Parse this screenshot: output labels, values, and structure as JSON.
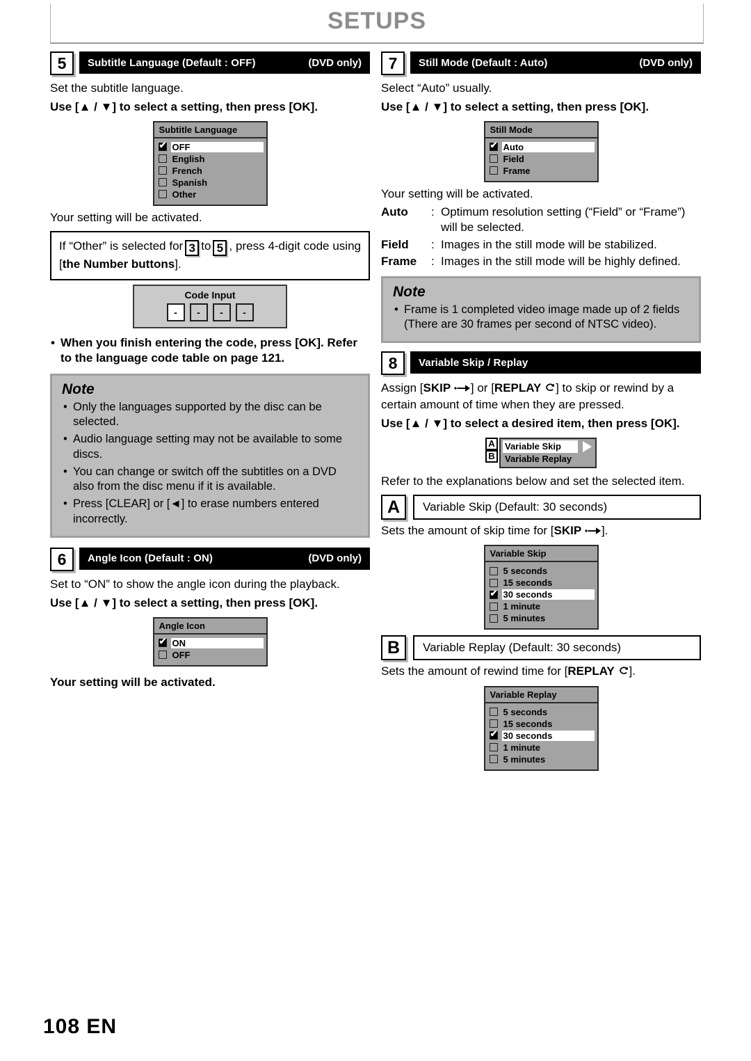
{
  "header": {
    "title": "SETUPS"
  },
  "footer": {
    "page": "108  EN"
  },
  "left": {
    "section5": {
      "number": "5",
      "title": "Subtitle Language (Default : OFF)",
      "note_right": "(DVD only)",
      "intro": "Set the subtitle language.",
      "instruction": "Use [▲ / ▼] to select a setting, then press [OK].",
      "osd": {
        "title": "Subtitle Language",
        "items": [
          {
            "label": "OFF",
            "checked": true
          },
          {
            "label": "English",
            "checked": false
          },
          {
            "label": "French",
            "checked": false
          },
          {
            "label": "Spanish",
            "checked": false
          },
          {
            "label": "Other",
            "checked": false
          }
        ]
      },
      "activated": "Your setting will be activated.",
      "callout": {
        "part1": "If “Other” is selected for",
        "num1": "3",
        "mid": "to",
        "num2": "5",
        "part2": ", press 4-digit code using [",
        "bold": "the Number buttons",
        "part3": "]."
      },
      "code_input": {
        "title": "Code Input",
        "digits": [
          "-",
          "-",
          "-",
          "-"
        ]
      },
      "bullet": "When you finish entering the code, press [OK]. Refer to the language code table on page 121.",
      "note": {
        "title": "Note",
        "items": [
          "Only the languages supported by the disc can be selected.",
          "Audio language setting may not be available to some discs.",
          "You can change or switch off the subtitles on a DVD also from the disc menu if it is available.",
          "Press [CLEAR] or [◄] to erase numbers entered incorrectly."
        ]
      }
    },
    "section6": {
      "number": "6",
      "title": "Angle Icon (Default : ON)",
      "note_right": "(DVD only)",
      "intro": "Set to “ON” to show the angle icon during the playback.",
      "instruction": "Use [▲ / ▼] to select a setting, then press [OK].",
      "osd": {
        "title": "Angle Icon",
        "items": [
          {
            "label": "ON",
            "checked": true
          },
          {
            "label": "OFF",
            "checked": false
          }
        ]
      },
      "activated": "Your setting will be activated."
    }
  },
  "right": {
    "section7": {
      "number": "7",
      "title": "Still Mode (Default : Auto)",
      "note_right": "(DVD only)",
      "intro": "Select “Auto” usually.",
      "instruction": "Use [▲ / ▼] to select a setting, then press [OK].",
      "osd": {
        "title": "Still Mode",
        "items": [
          {
            "label": "Auto",
            "checked": true
          },
          {
            "label": "Field",
            "checked": false
          },
          {
            "label": "Frame",
            "checked": false
          }
        ]
      },
      "activated": "Your setting will be activated.",
      "definitions": [
        {
          "term": "Auto",
          "sep": ":",
          "desc": "Optimum resolution setting (“Field” or “Frame”) will be selected."
        },
        {
          "term": "Field",
          "sep": ":",
          "desc": "Images in the still mode will be stabilized."
        },
        {
          "term": "Frame",
          "sep": ":",
          "desc": "Images in the still mode will be highly defined."
        }
      ],
      "note": {
        "title": "Note",
        "items": [
          "Frame is 1 completed video image made up of 2 fields (There are 30 frames per second of NTSC video)."
        ]
      }
    },
    "section8": {
      "number": "8",
      "title": "Variable Skip / Replay",
      "intro_before_skip": "Assign [",
      "skip_label": "SKIP",
      "skip_icon": "skip-forward-icon",
      "intro_mid": "] or [",
      "replay_label": "REPLAY",
      "replay_icon": "replay-loop-icon",
      "intro_after": "] to skip or rewind by a certain amount of time when they are pressed.",
      "instruction": "Use [▲ / ▼] to select a desired item, then press [OK].",
      "ab_osd": {
        "letters": [
          "A",
          "B"
        ],
        "items": [
          {
            "label": "Variable Skip",
            "selected": true
          },
          {
            "label": "Variable Replay",
            "selected": false
          }
        ]
      },
      "refer": "Refer to the explanations below and set the selected item.",
      "itemA": {
        "letter": "A",
        "bar": "Variable Skip (Default: 30 seconds)",
        "desc_before": "Sets the amount of skip time for [",
        "desc_label": "SKIP",
        "desc_after": "].",
        "osd": {
          "title": "Variable Skip",
          "items": [
            {
              "label": "5 seconds",
              "checked": false
            },
            {
              "label": "15 seconds",
              "checked": false
            },
            {
              "label": "30 seconds",
              "checked": true
            },
            {
              "label": "1 minute",
              "checked": false
            },
            {
              "label": "5 minutes",
              "checked": false
            }
          ]
        }
      },
      "itemB": {
        "letter": "B",
        "bar": "Variable Replay (Default: 30 seconds)",
        "desc_before": "Sets the amount of rewind time for [",
        "desc_label": "REPLAY",
        "desc_after": "].",
        "osd": {
          "title": "Variable Replay",
          "items": [
            {
              "label": "5 seconds",
              "checked": false
            },
            {
              "label": "15 seconds",
              "checked": false
            },
            {
              "label": "30 seconds",
              "checked": true
            },
            {
              "label": "1 minute",
              "checked": false
            },
            {
              "label": "5 minutes",
              "checked": false
            }
          ]
        }
      }
    }
  }
}
